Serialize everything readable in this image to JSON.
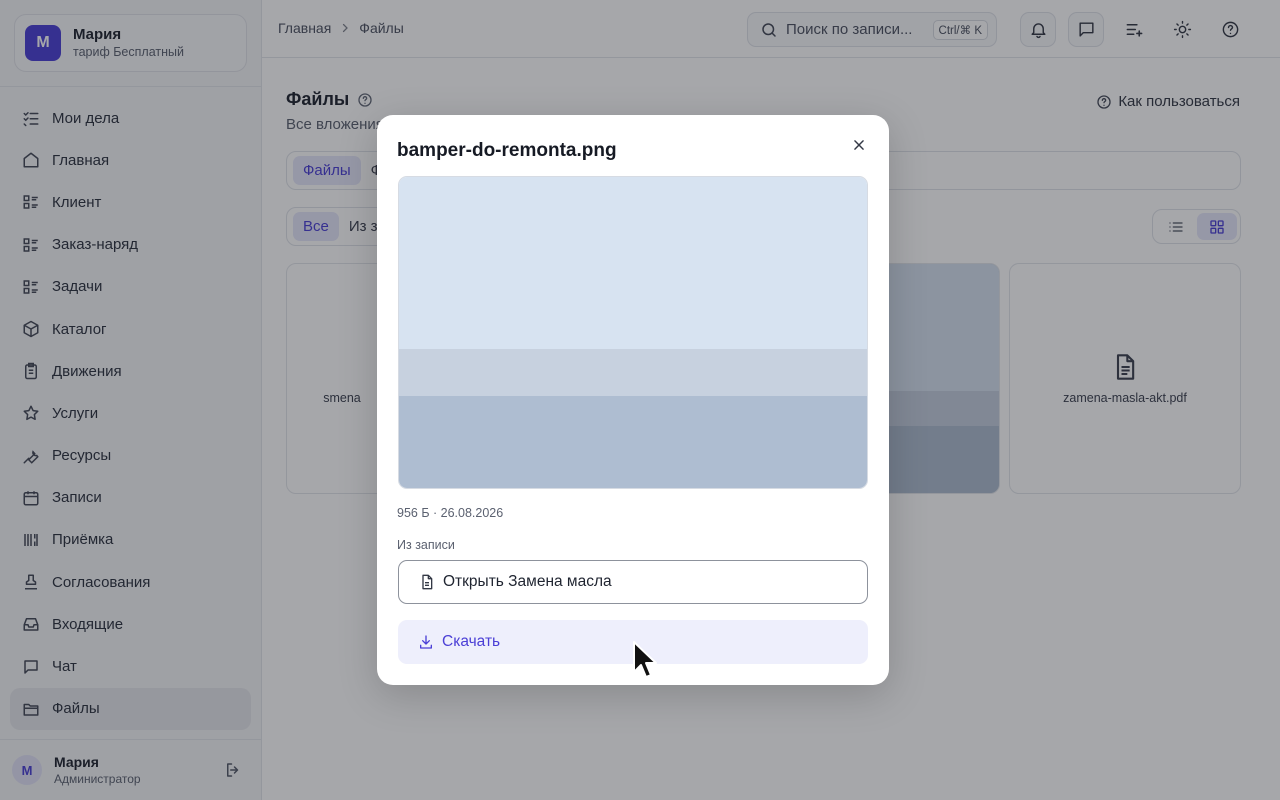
{
  "org": {
    "avatar_letter": "М",
    "name": "Мария",
    "plan": "тариф Бесплатный"
  },
  "sidebar": {
    "items": [
      {
        "label": "Мои дела",
        "icon": "checklist-icon"
      },
      {
        "label": "Главная",
        "icon": "home-icon"
      },
      {
        "label": "Клиент",
        "icon": "list-icon"
      },
      {
        "label": "Заказ-наряд",
        "icon": "list-icon"
      },
      {
        "label": "Задачи",
        "icon": "list-icon"
      },
      {
        "label": "Каталог",
        "icon": "box-icon"
      },
      {
        "label": "Движения",
        "icon": "clipboard-icon"
      },
      {
        "label": "Услуги",
        "icon": "star-icon"
      },
      {
        "label": "Ресурсы",
        "icon": "wrench-icon"
      },
      {
        "label": "Записи",
        "icon": "calendar-icon"
      },
      {
        "label": "Приёмка",
        "icon": "scan-icon"
      },
      {
        "label": "Согласования",
        "icon": "stamp-icon"
      },
      {
        "label": "Входящие",
        "icon": "inbox-icon"
      },
      {
        "label": "Чат",
        "icon": "chat-icon"
      },
      {
        "label": "Файлы",
        "icon": "folder-icon",
        "active": true
      }
    ],
    "user": {
      "avatar_letter": "М",
      "name": "Мария",
      "role": "Администратор"
    }
  },
  "topbar": {
    "breadcrumbs": [
      "Главная",
      "Файлы"
    ],
    "search_placeholder": "Поиск по записи...",
    "shortcut": "Ctrl/⌘ K"
  },
  "page": {
    "title": "Файлы",
    "subtitle": "Все вложения",
    "help_link": "Как пользоваться",
    "tabs": [
      {
        "label": "Файлы",
        "active": true
      },
      {
        "label": "Ф"
      }
    ],
    "filters": [
      {
        "label": "Все",
        "active": true
      },
      {
        "label": "Из з"
      }
    ],
    "cards": [
      {
        "name": "smena"
      },
      {
        "name": ""
      },
      {
        "name": ""
      },
      {
        "name": "zamena-masla-akt.pdf"
      }
    ]
  },
  "modal": {
    "title": "bamper-do-remonta.png",
    "meta": "956 Б · 26.08.2026",
    "from_label": "Из записи",
    "open_button": "Открыть Замена масла",
    "download_button": "Скачать"
  },
  "colors": {
    "accent": "#4b3fd6",
    "overlay": "rgba(20,24,32,0.38)"
  }
}
